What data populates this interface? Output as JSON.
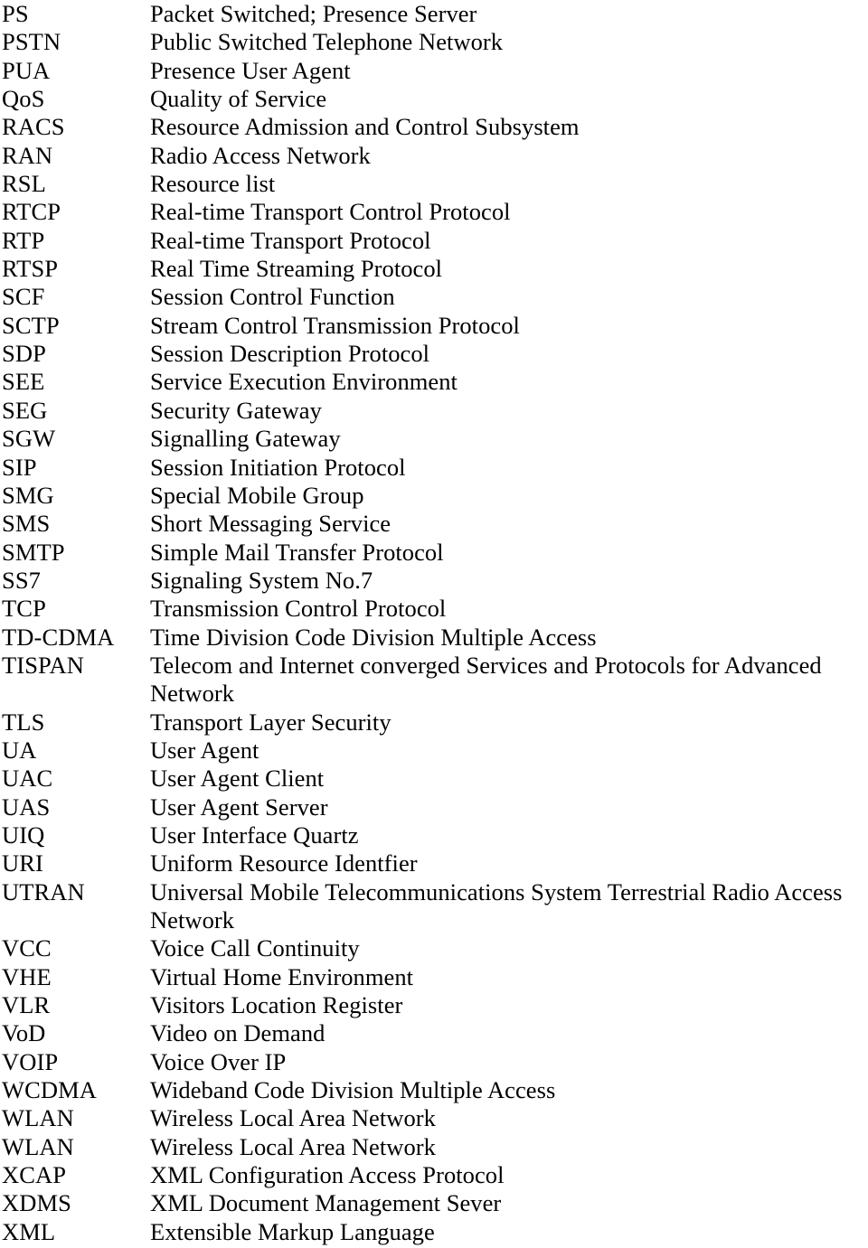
{
  "document": {
    "type": "abbreviations-glossary",
    "font_color": "#000000",
    "background_color": "#ffffff"
  },
  "entries": [
    {
      "abbr": "PS",
      "definition": "Packet Switched; Presence Server"
    },
    {
      "abbr": "PSTN",
      "definition": "Public Switched Telephone Network"
    },
    {
      "abbr": "PUA",
      "definition": "Presence User Agent"
    },
    {
      "abbr": "QoS",
      "definition": "Quality of Service"
    },
    {
      "abbr": "RACS",
      "definition": "Resource Admission and Control Subsystem"
    },
    {
      "abbr": "RAN",
      "definition": "Radio Access Network"
    },
    {
      "abbr": "RSL",
      "definition": "Resource list"
    },
    {
      "abbr": "RTCP",
      "definition": "Real-time Transport Control Protocol"
    },
    {
      "abbr": "RTP",
      "definition": "Real-time Transport Protocol"
    },
    {
      "abbr": "RTSP",
      "definition": "Real Time Streaming Protocol"
    },
    {
      "abbr": "SCF",
      "definition": "Session Control Function"
    },
    {
      "abbr": "SCTP",
      "definition": "Stream Control Transmission Protocol"
    },
    {
      "abbr": "SDP",
      "definition": "Session Description Protocol"
    },
    {
      "abbr": "SEE",
      "definition": "Service Execution Environment"
    },
    {
      "abbr": "SEG",
      "definition": "Security Gateway"
    },
    {
      "abbr": "SGW",
      "definition": "Signalling Gateway"
    },
    {
      "abbr": "SIP",
      "definition": "Session Initiation Protocol"
    },
    {
      "abbr": "SMG",
      "definition": "Special Mobile Group"
    },
    {
      "abbr": "SMS",
      "definition": "Short Messaging Service"
    },
    {
      "abbr": "SMTP",
      "definition": "Simple Mail Transfer Protocol"
    },
    {
      "abbr": "SS7",
      "definition": "Signaling System No.7"
    },
    {
      "abbr": "TCP",
      "definition": "Transmission Control Protocol"
    },
    {
      "abbr": "TD-CDMA",
      "definition": "Time Division Code Division Multiple Access"
    },
    {
      "abbr": "TISPAN",
      "definition": "Telecom and Internet converged Services and Protocols for Advanced",
      "definition_line2": "Network"
    },
    {
      "abbr": "TLS",
      "definition": "Transport Layer Security"
    },
    {
      "abbr": "UA",
      "definition": "User Agent"
    },
    {
      "abbr": "UAC",
      "definition": "User Agent Client"
    },
    {
      "abbr": "UAS",
      "definition": "User Agent Server"
    },
    {
      "abbr": "UIQ",
      "definition": "User Interface Quartz"
    },
    {
      "abbr": "URI",
      "definition": "Uniform Resource Identfier"
    },
    {
      "abbr": "UTRAN",
      "definition": "Universal Mobile Telecommunications System Terrestrial Radio Access",
      "definition_line2": "Network"
    },
    {
      "abbr": "VCC",
      "definition": "Voice Call Continuity"
    },
    {
      "abbr": "VHE",
      "definition": "Virtual Home Environment"
    },
    {
      "abbr": "VLR",
      "definition": "Visitors Location Register"
    },
    {
      "abbr": "VoD",
      "definition": "Video on Demand"
    },
    {
      "abbr": "VOIP",
      "definition": "Voice Over IP"
    },
    {
      "abbr": "WCDMA",
      "definition": "Wideband Code Division Multiple Access"
    },
    {
      "abbr": "WLAN",
      "definition": "Wireless Local Area Network"
    },
    {
      "abbr": "WLAN",
      "definition": "Wireless Local Area Network"
    },
    {
      "abbr": "XCAP",
      "definition": "XML Configuration Access Protocol"
    },
    {
      "abbr": "XDMS",
      "definition": "XML Document Management Sever"
    },
    {
      "abbr": "XML",
      "definition": "Extensible Markup Language"
    }
  ]
}
